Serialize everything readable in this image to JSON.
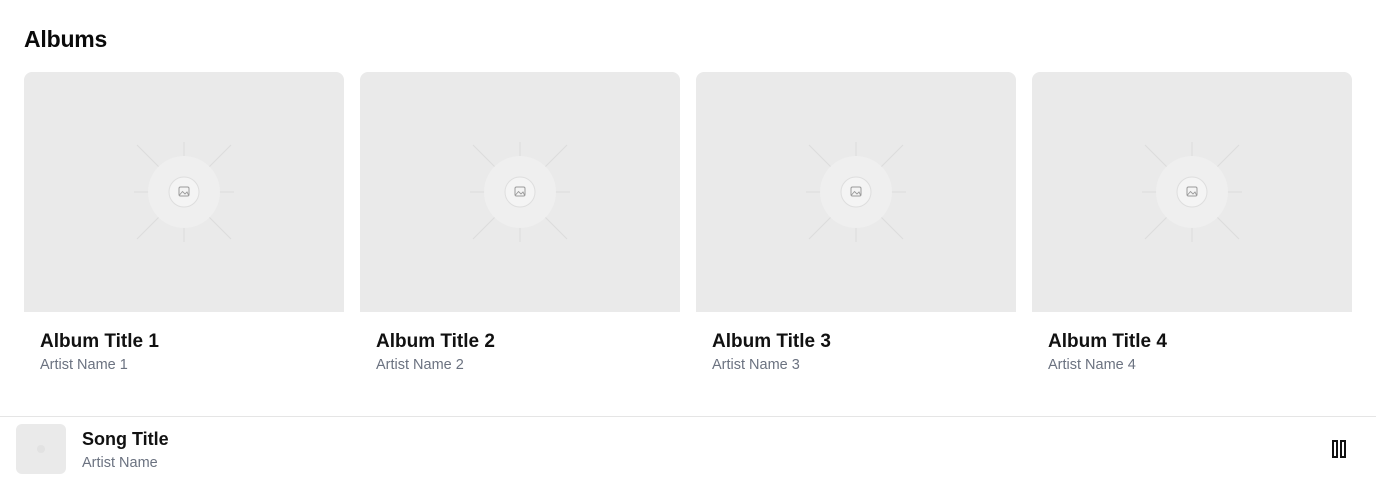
{
  "section": {
    "title": "Albums"
  },
  "albums": [
    {
      "title": "Album Title 1",
      "artist": "Artist Name 1"
    },
    {
      "title": "Album Title 2",
      "artist": "Artist Name 2"
    },
    {
      "title": "Album Title 3",
      "artist": "Artist Name 3"
    },
    {
      "title": "Album Title 4",
      "artist": "Artist Name 4"
    }
  ],
  "player": {
    "song_title": "Song Title",
    "artist": "Artist Name",
    "control_icon": "pause-icon"
  },
  "colors": {
    "placeholder_bg": "#eaeaea",
    "secondary_text": "#6b7280",
    "primary_text": "#111111",
    "divider": "#e5e5e5"
  }
}
